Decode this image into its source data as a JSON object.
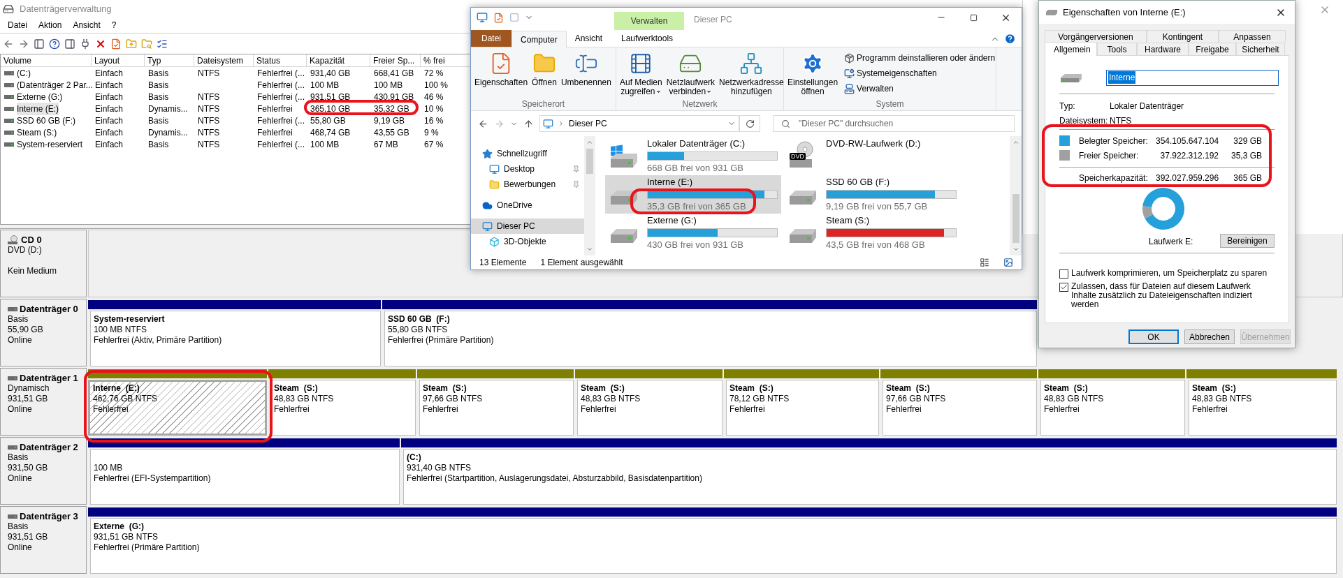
{
  "disk_management": {
    "title": "Datenträgerverwaltung",
    "menu": [
      "Datei",
      "Aktion",
      "Ansicht",
      "?"
    ],
    "columns": [
      "Volume",
      "Layout",
      "Typ",
      "Dateisystem",
      "Status",
      "Kapazität",
      "Freier Sp...",
      "% frei"
    ],
    "volumes": [
      {
        "selected": false,
        "cells": [
          "(C:)",
          "Einfach",
          "Basis",
          "NTFS",
          "Fehlerfrei (...",
          "931,40 GB",
          "668,41 GB",
          "72 %"
        ]
      },
      {
        "selected": false,
        "cells": [
          "(Datenträger 2 Par...",
          "Einfach",
          "Basis",
          null,
          "Fehlerfrei (...",
          "100 MB",
          "100 MB",
          "100 %"
        ]
      },
      {
        "selected": false,
        "cells": [
          "Externe (G:)",
          "Einfach",
          "Basis",
          "NTFS",
          "Fehlerfrei (...",
          "931,51 GB",
          "430,91 GB",
          "46 %"
        ]
      },
      {
        "selected": true,
        "cells": [
          "Interne (E:)",
          "Einfach",
          "Dynamis...",
          "NTFS",
          "Fehlerfrei",
          "365,10 GB",
          "35,32 GB",
          "10 %"
        ]
      },
      {
        "selected": false,
        "cells": [
          "SSD 60 GB (F:)",
          "Einfach",
          "Basis",
          "NTFS",
          "Fehlerfrei (...",
          "55,80 GB",
          "9,19 GB",
          "16 %"
        ]
      },
      {
        "selected": false,
        "cells": [
          "Steam (S:)",
          "Einfach",
          "Dynamis...",
          "NTFS",
          "Fehlerfrei",
          "468,74 GB",
          "43,55 GB",
          "9 %"
        ]
      },
      {
        "selected": false,
        "cells": [
          "System-reserviert",
          "Einfach",
          "Basis",
          "NTFS",
          "Fehlerfrei (...",
          "100 MB",
          "67 MB",
          "67 %"
        ]
      }
    ],
    "disks": [
      {
        "name": "CD 0",
        "kind": "cd",
        "type": "DVD (D:)",
        "status": "Kein Medium"
      },
      {
        "name": "Datenträger 0",
        "kind": "disk",
        "type": "Basis",
        "size": "55,90 GB",
        "status": "Online",
        "partitions": [
          {
            "title": "System-reserviert",
            "size": "100 MB NTFS",
            "status": "Fehlerfrei (Aktiv, Primäre Partition)",
            "color": "#000080",
            "selected": false
          },
          {
            "title": "SSD 60 GB  (F:)",
            "size": "55,80 GB NTFS",
            "status": "Fehlerfrei (Primäre Partition)",
            "color": "#000080",
            "selected": false
          }
        ]
      },
      {
        "name": "Datenträger 1",
        "kind": "disk",
        "type": "Dynamisch",
        "size": "931,51 GB",
        "status": "Online",
        "partitions": [
          {
            "title": "Interne  (E:)",
            "size": "462,76 GB NTFS",
            "status": "Fehlerfrei",
            "color": "#808000",
            "selected": true
          },
          {
            "title": "Steam  (S:)",
            "size": "48,83 GB NTFS",
            "status": "Fehlerfrei",
            "color": "#808000",
            "selected": false
          },
          {
            "title": "Steam  (S:)",
            "size": "97,66 GB NTFS",
            "status": "Fehlerfrei",
            "color": "#808000",
            "selected": false
          },
          {
            "title": "Steam  (S:)",
            "size": "48,83 GB NTFS",
            "status": "Fehlerfrei",
            "color": "#808000",
            "selected": false
          },
          {
            "title": "Steam  (S:)",
            "size": "78,12 GB NTFS",
            "status": "Fehlerfrei",
            "color": "#808000",
            "selected": false
          },
          {
            "title": "Steam  (S:)",
            "size": "97,66 GB NTFS",
            "status": "Fehlerfrei",
            "color": "#808000",
            "selected": false
          },
          {
            "title": "Steam  (S:)",
            "size": "48,83 GB NTFS",
            "status": "Fehlerfrei",
            "color": "#808000",
            "selected": false
          },
          {
            "title": "Steam  (S:)",
            "size": "48,83 GB NTFS",
            "status": "Fehlerfrei",
            "color": "#808000",
            "selected": false
          }
        ]
      },
      {
        "name": "Datenträger 2",
        "kind": "disk",
        "type": "Basis",
        "size": "931,50 GB",
        "status": "Online",
        "partitions": [
          {
            "size": "100 MB",
            "status": "Fehlerfrei (EFI-Systempartition)",
            "color": "#000080",
            "selected": false
          },
          {
            "title": "(C:)",
            "size": "931,40 GB NTFS",
            "status": "Fehlerfrei (Startpartition, Auslagerungsdatei, Absturzabbild, Basisdatenpartition)",
            "color": "#000080",
            "selected": false
          }
        ]
      },
      {
        "name": "Datenträger 3",
        "kind": "disk",
        "type": "Basis",
        "size": "931,51 GB",
        "status": "Online",
        "partitions": [
          {
            "title": "Externe  (G:)",
            "size": "931,51 GB NTFS",
            "status": "Fehlerfrei (Primäre Partition)",
            "color": "#000080",
            "selected": false
          }
        ]
      }
    ]
  },
  "explorer": {
    "title": "Dieser PC",
    "context_tab": "Verwalten",
    "tabs": [
      {
        "label": "Datei",
        "kind": "file",
        "selected": false
      },
      {
        "label": "Computer",
        "kind": "tab",
        "selected": true
      },
      {
        "label": "Ansicht",
        "kind": "tab",
        "selected": false
      },
      {
        "label": "Laufwerktools",
        "kind": "tab",
        "selected": false
      }
    ],
    "ribbon": [
      {
        "group": "Speicherort",
        "buttons": [
          {
            "kind": "properties",
            "lines": [
              "Eigenschaften"
            ],
            "dropdown": false
          },
          {
            "kind": "open",
            "lines": [
              "Öffnen"
            ],
            "dropdown": false
          },
          {
            "kind": "rename",
            "lines": [
              "Umbenennen"
            ],
            "dropdown": false
          }
        ]
      },
      {
        "group": "Netzwerk",
        "buttons": [
          {
            "kind": "media",
            "lines": [
              "Auf Medien",
              "zugreifen"
            ],
            "dropdown": true
          },
          {
            "kind": "netdrive",
            "lines": [
              "Netzlaufwerk",
              "verbinden"
            ],
            "dropdown": true
          },
          {
            "kind": "netaddress",
            "lines": [
              "Netzwerkadresse",
              "hinzufügen"
            ],
            "dropdown": false
          }
        ]
      },
      {
        "group": "System",
        "buttons": [
          {
            "kind": "settings",
            "lines": [
              "Einstellungen",
              "öffnen"
            ],
            "dropdown": false
          }
        ],
        "links": [
          {
            "kind": "uninstall",
            "label": "Programm deinstallieren oder ändern"
          },
          {
            "kind": "sysprops",
            "label": "Systemeigenschaften"
          },
          {
            "kind": "manage",
            "label": "Verwalten"
          }
        ]
      }
    ],
    "address": "Dieser PC",
    "search": {
      "placeholder": "\"Dieser PC\" durchsuchen"
    },
    "nav": [
      {
        "label": "Schnellzugriff",
        "kind": "star",
        "selected": false,
        "children": [
          {
            "label": "Desktop",
            "kind": "desktop",
            "pinned": true,
            "selected": false
          },
          {
            "label": "Bewerbungen",
            "kind": "folder",
            "pinned": true,
            "selected": false
          }
        ]
      },
      {
        "label": "OneDrive",
        "kind": "cloud",
        "selected": false
      },
      {
        "label": "Dieser PC",
        "kind": "pc",
        "selected": true,
        "children": [
          {
            "label": "3D-Objekte",
            "kind": "cube",
            "selected": false
          }
        ]
      }
    ],
    "drives": [
      {
        "name": "Lokaler Datenträger (C:)",
        "kind": "system",
        "free": "668 GB frei von 931 GB",
        "level": 0.28,
        "color": "#26a0da",
        "selected": false
      },
      {
        "name": "DVD-RW-Laufwerk (D:)",
        "kind": "dvd",
        "icon_label": "DVD",
        "selected": false
      },
      {
        "name": "Interne (E:)",
        "kind": "disk",
        "free": "35,3 GB frei von 365 GB",
        "level": 0.9,
        "color": "#26a0da",
        "selected": true
      },
      {
        "name": "SSD 60 GB (F:)",
        "kind": "disk",
        "free": "9,19 GB frei von 55,7 GB",
        "level": 0.84,
        "color": "#26a0da",
        "selected": false
      },
      {
        "name": "Externe (G:)",
        "kind": "disk",
        "free": "430 GB frei von 931 GB",
        "level": 0.54,
        "color": "#26a0da",
        "selected": false
      },
      {
        "name": "Steam (S:)",
        "kind": "disk",
        "free": "43,5 GB frei von 468 GB",
        "level": 0.91,
        "color": "#da2626",
        "selected": false
      }
    ],
    "status_bar": [
      "13 Elemente",
      "1 Element ausgewählt"
    ]
  },
  "properties": {
    "title": "Eigenschaften von Interne (E:)",
    "tab_rows": [
      [
        {
          "label": "Vorgängerversionen",
          "selected": false
        },
        {
          "label": "Kontingent",
          "selected": false
        },
        {
          "label": "Anpassen",
          "selected": false
        }
      ],
      [
        {
          "label": "Allgemein",
          "selected": true
        },
        {
          "label": "Tools",
          "selected": false
        },
        {
          "label": "Hardware",
          "selected": false
        },
        {
          "label": "Freigabe",
          "selected": false
        },
        {
          "label": "Sicherheit",
          "selected": false
        }
      ]
    ],
    "name_value": "Interne",
    "info": [
      {
        "label": "Typ:",
        "value": "Lokaler Datenträger"
      },
      {
        "label": "Dateisystem:",
        "value": "NTFS"
      }
    ],
    "usage": [
      {
        "label": "Belegter Speicher:",
        "bytes": "354.105.647.104",
        "size": "329 GB",
        "color": "#26a0da"
      },
      {
        "label": "Freier Speicher:",
        "bytes": "37.922.312.192",
        "size": "35,3 GB",
        "color": "#a0a0a0"
      }
    ],
    "capacity": {
      "label": "Speicherkapazität:",
      "bytes": "392.027.959.296",
      "size": "365 GB"
    },
    "chart_data": {
      "type": "donut",
      "values": [
        90.3,
        9.7
      ]
    },
    "drive_label": "Laufwerk E:",
    "cleanup_button": "Bereinigen",
    "options": [
      {
        "label": "Laufwerk komprimieren, um Speicherplatz zu sparen",
        "checked": false
      },
      {
        "label": "Zulassen, dass für Dateien auf diesem Laufwerk Inhalte zusätzlich zu Dateieigenschaften indiziert werden",
        "checked": true
      }
    ],
    "buttons": [
      {
        "label": "OK",
        "default": true,
        "disabled": false
      },
      {
        "label": "Abbrechen",
        "default": false,
        "disabled": false
      },
      {
        "label": "Übernehmen",
        "default": false,
        "disabled": true
      }
    ]
  }
}
